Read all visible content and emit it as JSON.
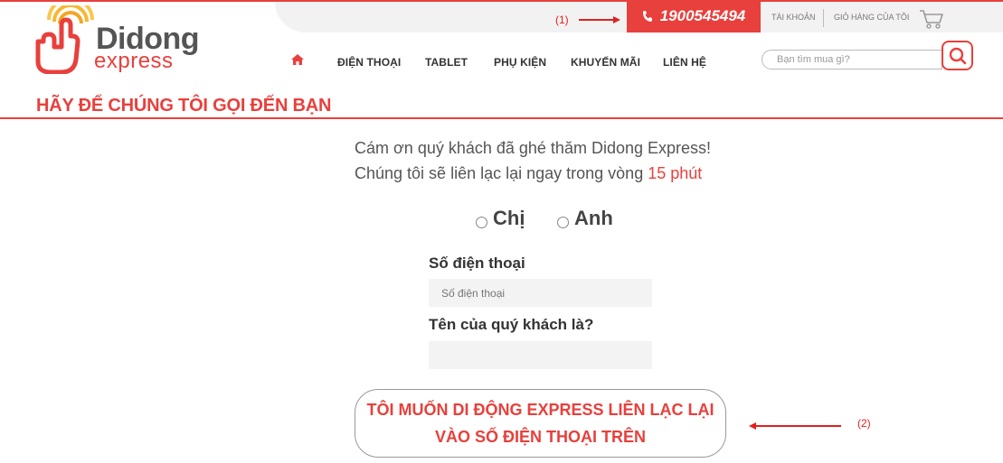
{
  "brand": {
    "logo_name": "Didong",
    "logo_sub": "express",
    "primary_color": "#e8403c",
    "logo_icon": "hand-signal-icon"
  },
  "annotations": {
    "one": "(1)",
    "two": "(2)"
  },
  "topbar": {
    "hotline": "1900545494",
    "hotline_icon": "phone-icon",
    "account": "TÀI KHOẢN",
    "cart": "GIỎ HÀNG CỦA TÔI",
    "cart_icon": "cart-icon"
  },
  "nav": {
    "home_icon": "home-icon",
    "items": [
      {
        "label": "ĐIỆN THOẠI"
      },
      {
        "label": "TABLET"
      },
      {
        "label": "PHỤ KIỆN"
      },
      {
        "label": "KHUYẾN MÃI"
      },
      {
        "label": "LIÊN HỆ"
      }
    ]
  },
  "search": {
    "placeholder": "Bạn tìm mua gì?",
    "icon": "search-icon"
  },
  "page": {
    "title": "HÃY ĐỂ CHÚNG TÔI GỌI ĐẾN BẠN",
    "intro_line1": "Cám ơn quý khách đã ghé thăm Didong Express!",
    "intro_line2_prefix": "Chúng tôi sẽ liên lạc lại ngay trong vòng ",
    "intro_line2_highlight": "15 phút"
  },
  "form": {
    "gender_options": [
      {
        "label": "Chị"
      },
      {
        "label": "Anh"
      }
    ],
    "phone_label": "Số điện thoại",
    "phone_placeholder": "Số điện thoại",
    "name_label": "Tên của quý khách là?",
    "name_placeholder": "",
    "submit_line1": "TÔI MUỐN DI ĐỘNG EXPRESS LIÊN LẠC LẠI",
    "submit_line2": "VÀO SỐ ĐIỆN THOẠI TRÊN"
  }
}
